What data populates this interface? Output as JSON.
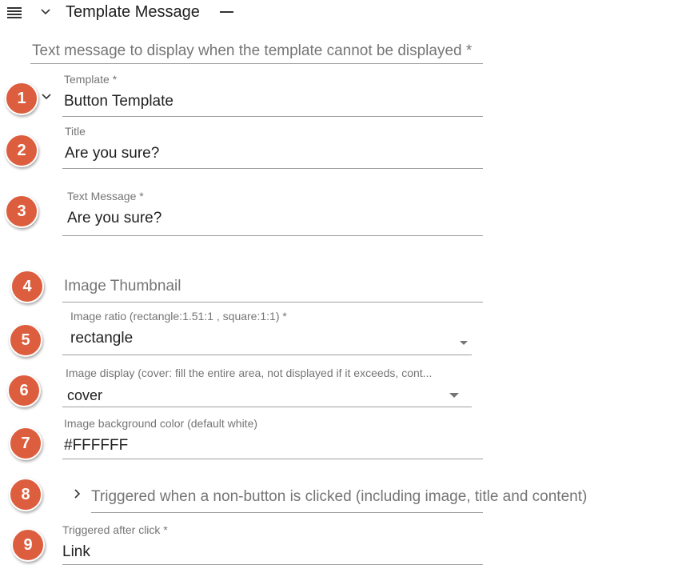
{
  "header": {
    "title": "Template Message",
    "collapse_symbol": "—"
  },
  "fields": {
    "alt_text": {
      "placeholder": "Text message to display when the template cannot be displayed *"
    },
    "template": {
      "label": "Template *",
      "value": "Button Template"
    },
    "title": {
      "label": "Title",
      "value": "Are you sure?"
    },
    "text_message": {
      "label": "Text Message *",
      "value": "Are you sure?"
    },
    "image_thumbnail": {
      "placeholder": "Image Thumbnail"
    },
    "image_ratio": {
      "label": "Image ratio (rectangle:1.51:1 , square:1:1) *",
      "value": "rectangle"
    },
    "image_display": {
      "label": "Image display (cover: fill the entire area, not displayed if it exceeds, cont...",
      "value": "cover"
    },
    "image_bg": {
      "label": "Image background color (default white)",
      "value": "#FFFFFF"
    },
    "non_button_action": {
      "label": "Triggered when a non-button is clicked (including image, title and content)"
    },
    "after_click": {
      "label": "Triggered after click *",
      "value": "Link"
    }
  },
  "badges": [
    "1",
    "2",
    "3",
    "4",
    "5",
    "6",
    "7",
    "8",
    "9"
  ],
  "icons": {
    "menu": "menu-icon",
    "collapse": "chevron-down-icon",
    "expand": "chevron-right-icon",
    "dropdown": "dropdown-caret-icon"
  },
  "colors": {
    "badge": "#dd5e3e",
    "underline": "#9e9e9e",
    "label": "#757575",
    "text": "#212121"
  }
}
